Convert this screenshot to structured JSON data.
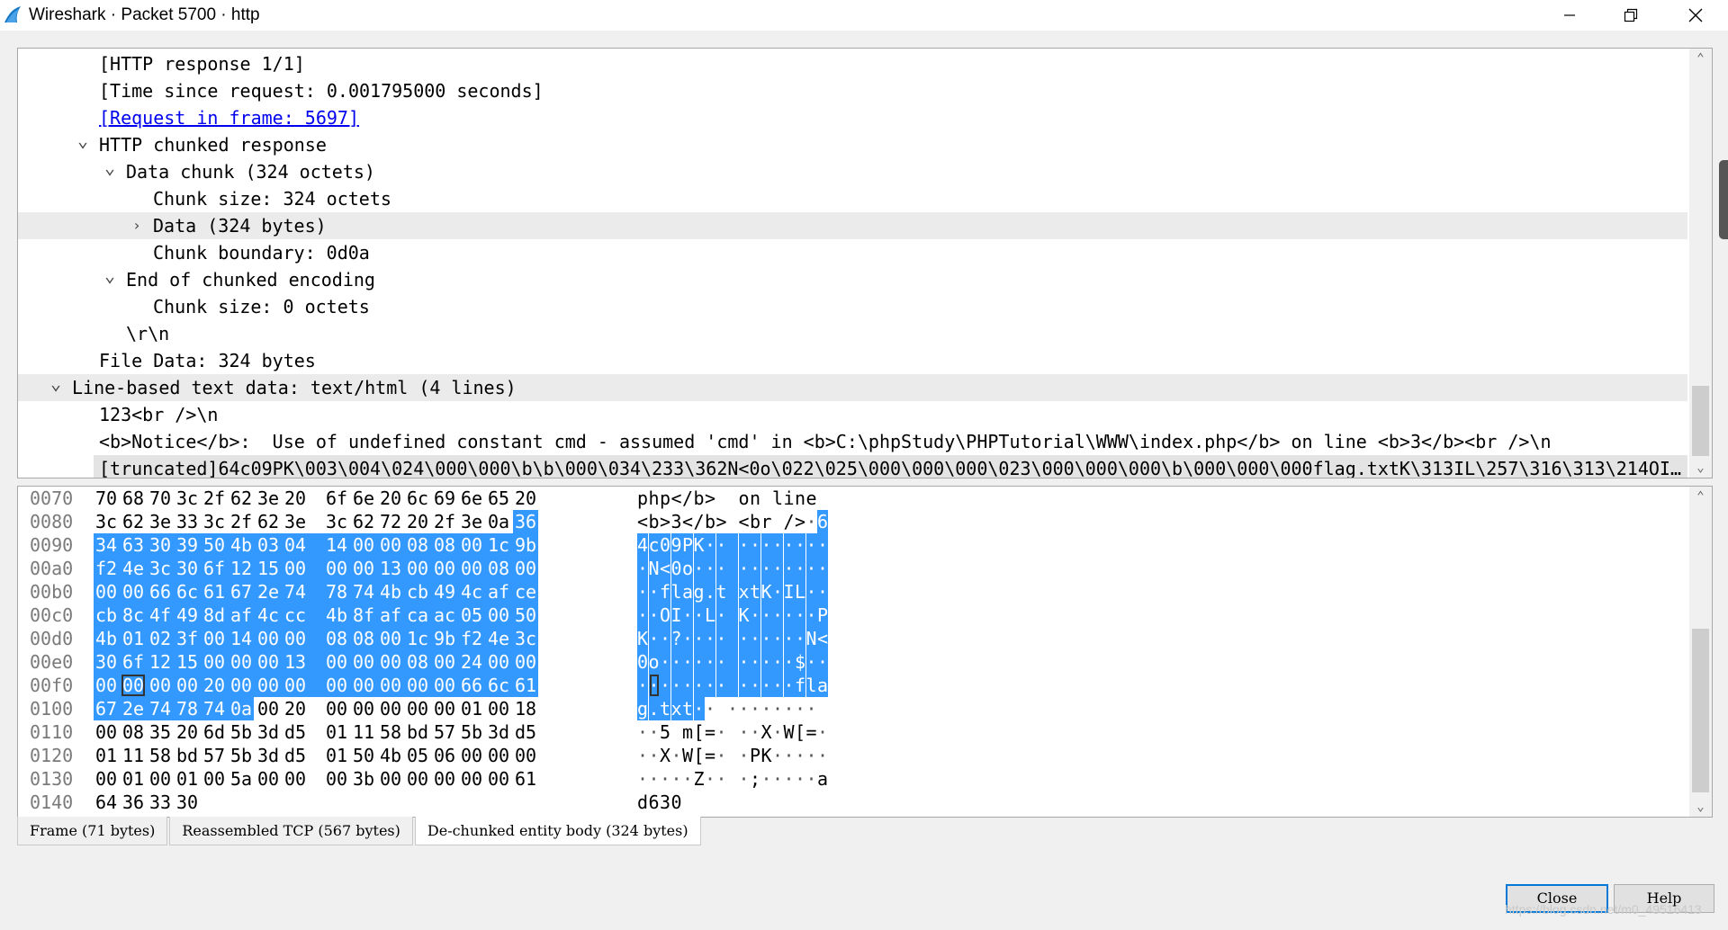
{
  "window": {
    "title": "Wireshark · Packet 5700 · http",
    "minimize_label": "—",
    "maximize_label": "❐",
    "close_label": "✕"
  },
  "tree": {
    "rows": [
      {
        "text": "[HTTP response 1/1]",
        "indent": 2,
        "arrow": ""
      },
      {
        "text": "[Time since request: 0.001795000 seconds]",
        "indent": 2,
        "arrow": ""
      },
      {
        "text": "[Request in frame: 5697]",
        "indent": 2,
        "arrow": "",
        "link": true
      },
      {
        "text": "HTTP chunked response",
        "indent": 2,
        "arrow": "down"
      },
      {
        "text": "Data chunk (324 octets)",
        "indent": 3,
        "arrow": "down"
      },
      {
        "text": "Chunk size: 324 octets",
        "indent": 4,
        "arrow": ""
      },
      {
        "text": "Data (324 bytes)",
        "indent": 4,
        "arrow": "right",
        "highlight": true
      },
      {
        "text": "Chunk boundary: 0d0a",
        "indent": 4,
        "arrow": ""
      },
      {
        "text": "End of chunked encoding",
        "indent": 3,
        "arrow": "down"
      },
      {
        "text": "Chunk size: 0 octets",
        "indent": 4,
        "arrow": ""
      },
      {
        "text": "\\r\\n",
        "indent": 3,
        "arrow": ""
      },
      {
        "text": "File Data: 324 bytes",
        "indent": 2,
        "arrow": ""
      },
      {
        "text": "Line-based text data: text/html (4 lines)",
        "indent": 1,
        "arrow": "down",
        "highlight": true
      },
      {
        "text": "123<br />\\n",
        "indent": 2,
        "arrow": ""
      },
      {
        "text": "<b>Notice</b>:  Use of undefined constant cmd - assumed 'cmd' in <b>C:\\phpStudy\\PHPTutorial\\WWW\\index.php</b> on line <b>3</b><br />\\n",
        "indent": 2,
        "arrow": ""
      },
      {
        "text": "[truncated]64c09PK\\003\\004\\024\\000\\000\\b\\b\\000\\034\\233\\362N<0o\\022\\025\\000\\000\\000\\023\\000\\000\\000\\b\\000\\000\\000flag.txtK\\313IL\\257\\316\\313\\214OI…",
        "indent": 2,
        "arrow": "",
        "selected": true
      }
    ]
  },
  "bytes": {
    "rows": [
      {
        "offset": "0070",
        "hex": [
          "70",
          "68",
          "70",
          "3c",
          "2f",
          "62",
          "3e",
          "20",
          "6f",
          "6e",
          "20",
          "6c",
          "69",
          "6e",
          "65",
          "20"
        ],
        "ascii": "php</b>  on line ",
        "sel_from": 99,
        "sel_to": -1
      },
      {
        "offset": "0080",
        "hex": [
          "3c",
          "62",
          "3e",
          "33",
          "3c",
          "2f",
          "62",
          "3e",
          "3c",
          "62",
          "72",
          "20",
          "2f",
          "3e",
          "0a",
          "36"
        ],
        "ascii": "<b>3</b> <br />·6",
        "sel_from": 15,
        "sel_to": 15
      },
      {
        "offset": "0090",
        "hex": [
          "34",
          "63",
          "30",
          "39",
          "50",
          "4b",
          "03",
          "04",
          "14",
          "00",
          "00",
          "08",
          "08",
          "00",
          "1c",
          "9b"
        ],
        "ascii": "4c09PK·· ········",
        "sel_from": 0,
        "sel_to": 15
      },
      {
        "offset": "00a0",
        "hex": [
          "f2",
          "4e",
          "3c",
          "30",
          "6f",
          "12",
          "15",
          "00",
          "00",
          "00",
          "13",
          "00",
          "00",
          "00",
          "08",
          "00"
        ],
        "ascii": "·N<0o··· ········",
        "sel_from": 0,
        "sel_to": 15
      },
      {
        "offset": "00b0",
        "hex": [
          "00",
          "00",
          "66",
          "6c",
          "61",
          "67",
          "2e",
          "74",
          "78",
          "74",
          "4b",
          "cb",
          "49",
          "4c",
          "af",
          "ce"
        ],
        "ascii": "··flag.t xtK·IL··",
        "sel_from": 0,
        "sel_to": 15
      },
      {
        "offset": "00c0",
        "hex": [
          "cb",
          "8c",
          "4f",
          "49",
          "8d",
          "af",
          "4c",
          "cc",
          "4b",
          "8f",
          "af",
          "ca",
          "ac",
          "05",
          "00",
          "50"
        ],
        "ascii": "··OI··L· K······P",
        "sel_from": 0,
        "sel_to": 15
      },
      {
        "offset": "00d0",
        "hex": [
          "4b",
          "01",
          "02",
          "3f",
          "00",
          "14",
          "00",
          "00",
          "08",
          "08",
          "00",
          "1c",
          "9b",
          "f2",
          "4e",
          "3c"
        ],
        "ascii": "K··?···· ······N<",
        "sel_from": 0,
        "sel_to": 15
      },
      {
        "offset": "00e0",
        "hex": [
          "30",
          "6f",
          "12",
          "15",
          "00",
          "00",
          "00",
          "13",
          "00",
          "00",
          "00",
          "08",
          "00",
          "24",
          "00",
          "00"
        ],
        "ascii": "0o······ ·····$··",
        "sel_from": 0,
        "sel_to": 15
      },
      {
        "offset": "00f0",
        "hex": [
          "00",
          "00",
          "00",
          "00",
          "20",
          "00",
          "00",
          "00",
          "00",
          "00",
          "00",
          "00",
          "00",
          "66",
          "6c",
          "61"
        ],
        "ascii": "········ ·····fla",
        "sel_from": 0,
        "sel_to": 15,
        "cursor": 1
      },
      {
        "offset": "0100",
        "hex": [
          "67",
          "2e",
          "74",
          "78",
          "74",
          "0a",
          "00",
          "20",
          "00",
          "00",
          "00",
          "00",
          "00",
          "01",
          "00",
          "18"
        ],
        "ascii": "g.txt·· ········",
        "sel_from": 0,
        "sel_to": 5
      },
      {
        "offset": "0110",
        "hex": [
          "00",
          "08",
          "35",
          "20",
          "6d",
          "5b",
          "3d",
          "d5",
          "01",
          "11",
          "58",
          "bd",
          "57",
          "5b",
          "3d",
          "d5"
        ],
        "ascii": "··5 m[=· ··X·W[=·",
        "sel_from": 99,
        "sel_to": -1
      },
      {
        "offset": "0120",
        "hex": [
          "01",
          "11",
          "58",
          "bd",
          "57",
          "5b",
          "3d",
          "d5",
          "01",
          "50",
          "4b",
          "05",
          "06",
          "00",
          "00",
          "00"
        ],
        "ascii": "··X·W[=· ·PK·····",
        "sel_from": 99,
        "sel_to": -1
      },
      {
        "offset": "0130",
        "hex": [
          "00",
          "01",
          "00",
          "01",
          "00",
          "5a",
          "00",
          "00",
          "00",
          "3b",
          "00",
          "00",
          "00",
          "00",
          "00",
          "61"
        ],
        "ascii": "·····Z·· ·;·····a",
        "sel_from": 99,
        "sel_to": -1
      },
      {
        "offset": "0140",
        "hex": [
          "64",
          "36",
          "33",
          "30"
        ],
        "ascii": "d630",
        "sel_from": 99,
        "sel_to": -1
      }
    ]
  },
  "tabs": [
    {
      "label": "Frame (71 bytes)",
      "active": false
    },
    {
      "label": "Reassembled TCP (567 bytes)",
      "active": false
    },
    {
      "label": "De-chunked entity body (324 bytes)",
      "active": true
    }
  ],
  "buttons": {
    "close_label": "Close",
    "help_label": "Help"
  },
  "watermark": "https://blog.csdn.net/m0_49516413",
  "colors": {
    "selection": "#3399ff",
    "link": "#0000ee",
    "accent": "#0078d7"
  }
}
